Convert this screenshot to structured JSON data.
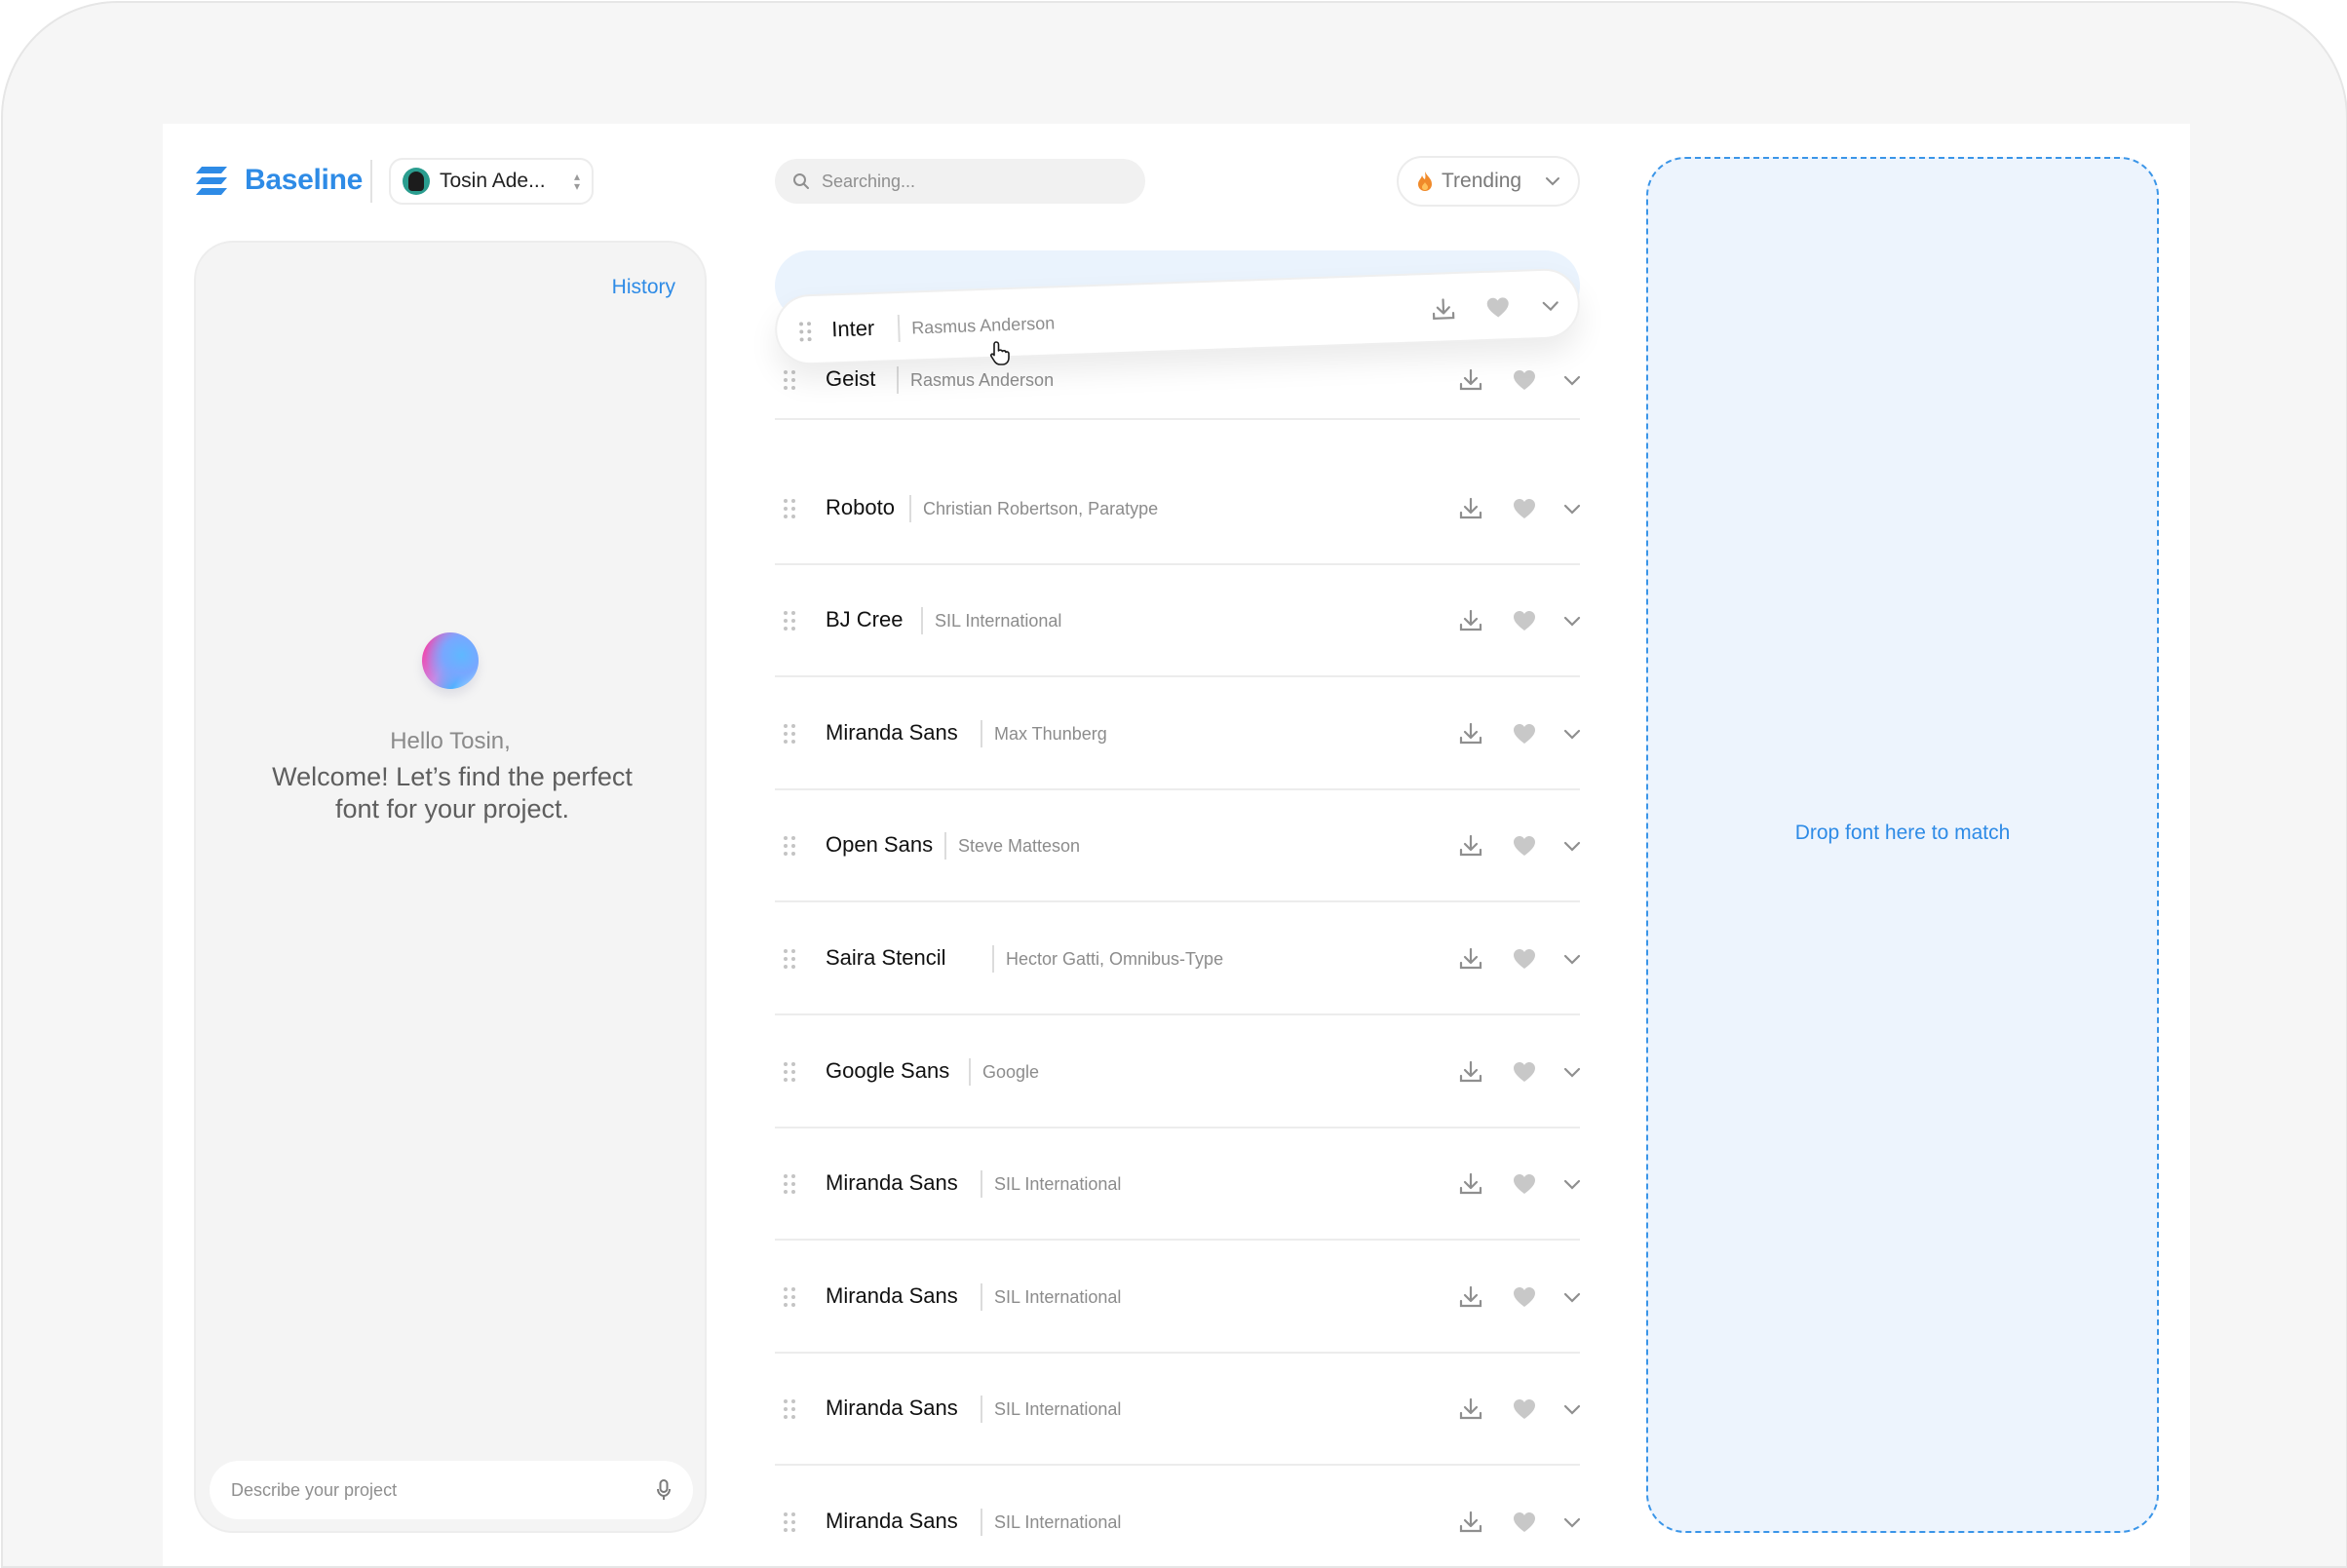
{
  "app": {
    "brand": "Baseline",
    "user": "Tosin Ade...",
    "search_placeholder": "Searching...",
    "sort": "Trending",
    "history": "History",
    "greeting": "Hello Tosin,",
    "welcome": "Welcome! Let’s find the perfect font for your project.",
    "prompt_placeholder": "Describe your project",
    "drop_hint": "Drop font here to match"
  },
  "colors": {
    "accent": "#2e8be6",
    "drop_fill": "#edf4fd",
    "trend_flame": "#f08a2a"
  },
  "dragging": {
    "name": "Inter",
    "foundry": "Rasmus Anderson"
  },
  "fonts": [
    {
      "name": "Geist",
      "foundry": "Rasmus Anderson"
    },
    {
      "name": "Roboto",
      "foundry": "Christian Robertson, Paratype"
    },
    {
      "name": "BJ Cree",
      "foundry": "SIL International"
    },
    {
      "name": "Miranda Sans",
      "foundry": "Max Thunberg"
    },
    {
      "name": "Open Sans",
      "foundry": "Steve Matteson"
    },
    {
      "name": "Saira Stencil",
      "foundry": "Hector Gatti, Omnibus-Type"
    },
    {
      "name": "Google Sans",
      "foundry": "Google"
    },
    {
      "name": "Miranda Sans",
      "foundry": "SIL International"
    },
    {
      "name": "Miranda Sans",
      "foundry": "SIL International"
    },
    {
      "name": "Miranda Sans",
      "foundry": "SIL International"
    },
    {
      "name": "Miranda Sans",
      "foundry": "SIL International"
    }
  ],
  "icons": [
    "logo-icon",
    "search-icon",
    "flame-icon",
    "chevron-down-icon",
    "drag-handle-icon",
    "download-icon",
    "heart-icon",
    "mic-icon",
    "pointer-cursor-icon",
    "updown-icon"
  ]
}
